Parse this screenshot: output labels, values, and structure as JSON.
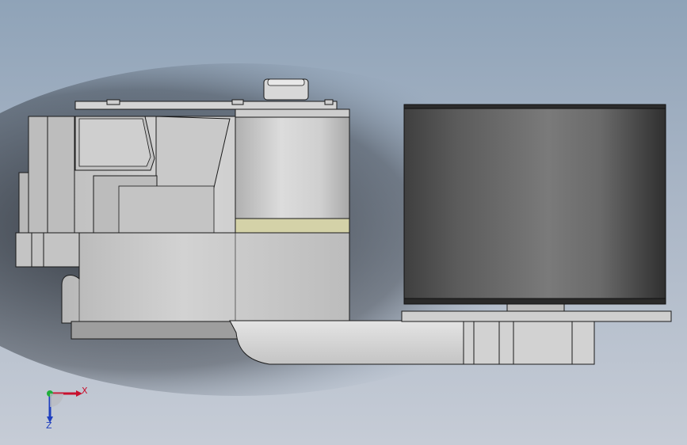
{
  "viewport": {
    "background_top": "#8fa3b8",
    "background_bottom": "#c6ccd6"
  },
  "model": {
    "housing_color": "#c9c9c9",
    "pulley_color": "#5a5a5a",
    "highlight_band_color": "#d4d2a8",
    "edge_color": "#1a1a1a"
  },
  "triad": {
    "x_label": "X",
    "z_label": "Z",
    "x_color": "#c8102e",
    "y_color": "#1fae3a",
    "z_color": "#1f3fbf"
  }
}
